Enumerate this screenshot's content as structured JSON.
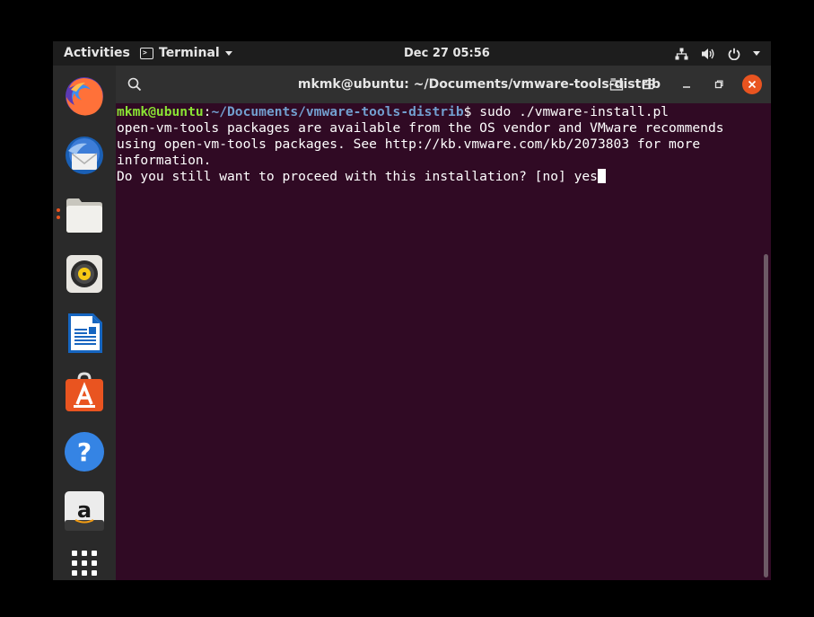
{
  "topbar": {
    "activities": "Activities",
    "app_menu_label": "Terminal",
    "clock": "Dec 27  05:56",
    "tray_icons": [
      "network-icon",
      "volume-icon",
      "power-icon",
      "chevron-down-icon"
    ]
  },
  "dock": {
    "apps": [
      {
        "name": "firefox-icon"
      },
      {
        "name": "thunderbird-icon"
      },
      {
        "name": "files-icon",
        "running": true
      },
      {
        "name": "rhythmbox-icon"
      },
      {
        "name": "libreoffice-writer-icon"
      },
      {
        "name": "ubuntu-software-icon"
      },
      {
        "name": "help-icon"
      },
      {
        "name": "amazon-icon"
      },
      {
        "name": "show-applications-icon"
      }
    ],
    "amazon_letter": "a",
    "help_glyph": "?"
  },
  "window": {
    "title": "mkmk@ubuntu: ~/Documents/vmware-tools-distrib"
  },
  "terminal": {
    "prompt_user": "mkmk@ubuntu",
    "prompt_sep": ":",
    "prompt_path": "~/Documents/vmware-tools-distrib",
    "prompt_end": "$ ",
    "command": "sudo ./vmware-install.pl",
    "output_lines": [
      "open-vm-tools packages are available from the OS vendor and VMware recommends",
      "using open-vm-tools packages. See http://kb.vmware.com/kb/2073803 for more",
      "information."
    ],
    "question": "Do you still want to proceed with this installation? [no] ",
    "typed": "yes"
  },
  "colors": {
    "terminal_bg": "#300a24",
    "prompt_user": "#8ae234",
    "prompt_path": "#729fcf",
    "accent": "#e95420"
  }
}
